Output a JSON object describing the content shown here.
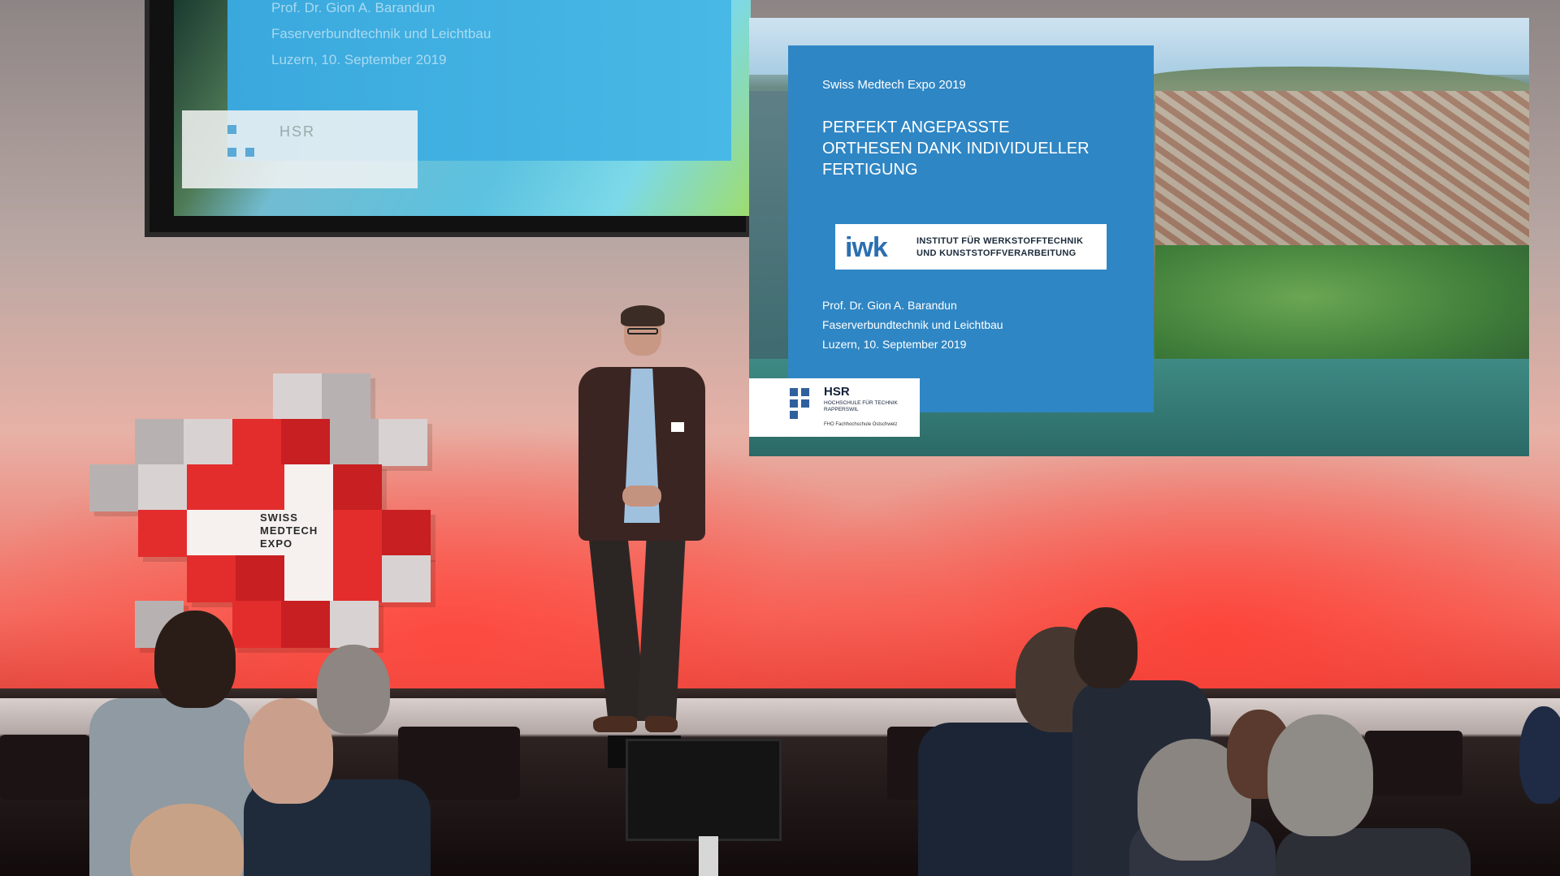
{
  "left_screen": {
    "lines": [
      "Prof. Dr. Gion A. Barandun",
      "Faserverbundtechnik und Leichtbau",
      "Luzern, 10. September 2019"
    ],
    "logo_text": "HSR"
  },
  "slide": {
    "event": "Swiss Medtech Expo 2019",
    "title": "PERFEKT ANGEPASSTE\nORTHESEN DANK INDIVIDUELLER\nFERTIGUNG",
    "iwk": {
      "mark": "iwk",
      "name_line1": "INSTITUT FÜR WERKSTOFFTECHNIK",
      "name_line2": "UND KUNSTSTOFFVERARBEITUNG"
    },
    "speaker_name": "Prof. Dr. Gion A. Barandun",
    "speaker_dept": "Faserverbundtechnik und Leichtbau",
    "speaker_date": "Luzern, 10. September 2019",
    "hsr": {
      "mark": "HSR",
      "sub_line1": "HOCHSCHULE FÜR TECHNIK",
      "sub_line2": "RAPPERSWIL",
      "fh": "FHO Fachhochschule Ostschweiz"
    }
  },
  "expo_logo": {
    "line1": "SWISS",
    "line2": "MEDTECH",
    "line3": "EXPO"
  },
  "colors": {
    "slide_blue": "#2f86c4",
    "expo_red": "#e32d2d",
    "stage_glow": "#f46e62"
  }
}
